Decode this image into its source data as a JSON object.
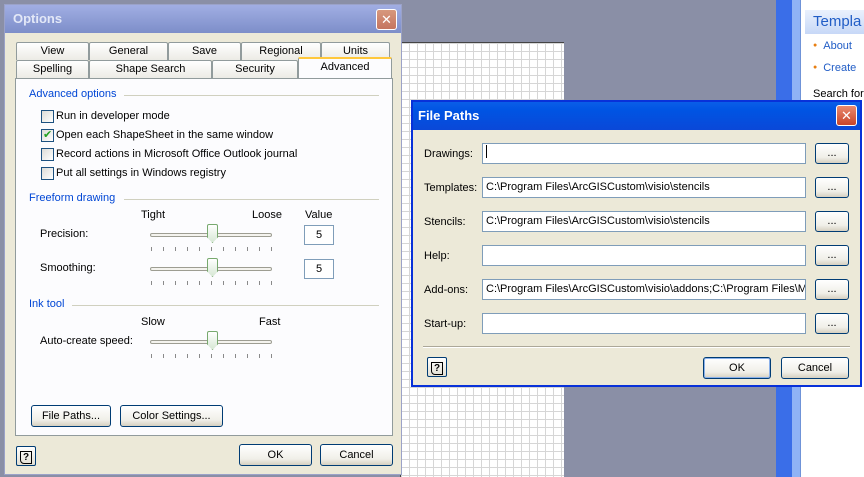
{
  "background": {
    "task_pane": {
      "title": "Templa",
      "links": [
        "About",
        "Create"
      ],
      "search_label": "Search for"
    }
  },
  "options_dialog": {
    "title": "Options",
    "tabs_row1": [
      "View",
      "General",
      "Save",
      "Regional",
      "Units"
    ],
    "tabs_row2": [
      "Spelling",
      "Shape Search",
      "Security",
      "Advanced"
    ],
    "selected_tab": "Advanced",
    "advanced_options": {
      "heading": "Advanced options",
      "checkboxes": [
        {
          "label": "Run in developer mode",
          "checked": false
        },
        {
          "label": "Open each ShapeSheet in the same window",
          "checked": true
        },
        {
          "label": "Record actions in Microsoft Office Outlook journal",
          "checked": false
        },
        {
          "label": "Put all settings in Windows registry",
          "checked": false
        }
      ]
    },
    "freeform": {
      "heading": "Freeform drawing",
      "tight_label": "Tight",
      "loose_label": "Loose",
      "value_label": "Value",
      "precision_label": "Precision:",
      "precision_value": "5",
      "smoothing_label": "Smoothing:",
      "smoothing_value": "5"
    },
    "ink_tool": {
      "heading": "Ink tool",
      "slow_label": "Slow",
      "fast_label": "Fast",
      "speed_label": "Auto-create speed:"
    },
    "buttons": {
      "file_paths": "File Paths...",
      "color_settings": "Color Settings...",
      "ok": "OK",
      "cancel": "Cancel"
    }
  },
  "file_paths_dialog": {
    "title": "File Paths",
    "rows": [
      {
        "label": "Drawings:",
        "value": ""
      },
      {
        "label": "Templates:",
        "value": "C:\\Program Files\\ArcGISCustom\\visio\\stencils"
      },
      {
        "label": "Stencils:",
        "value": "C:\\Program Files\\ArcGISCustom\\visio\\stencils"
      },
      {
        "label": "Help:",
        "value": ""
      },
      {
        "label": "Add-ons:",
        "value": "C:\\Program Files\\ArcGISCustom\\visio\\addons;C:\\Program Files\\Micr"
      },
      {
        "label": "Start-up:",
        "value": ""
      }
    ],
    "browse_label": "...",
    "ok": "OK",
    "cancel": "Cancel"
  },
  "icons": [
    "close-icon",
    "help-icon",
    "checkmark-icon"
  ],
  "colors": {
    "title_active": "#0054e3",
    "dialog_face": "#ece9d8",
    "group_heading": "#0046d5",
    "tab_highlight": "#ffc83c"
  }
}
